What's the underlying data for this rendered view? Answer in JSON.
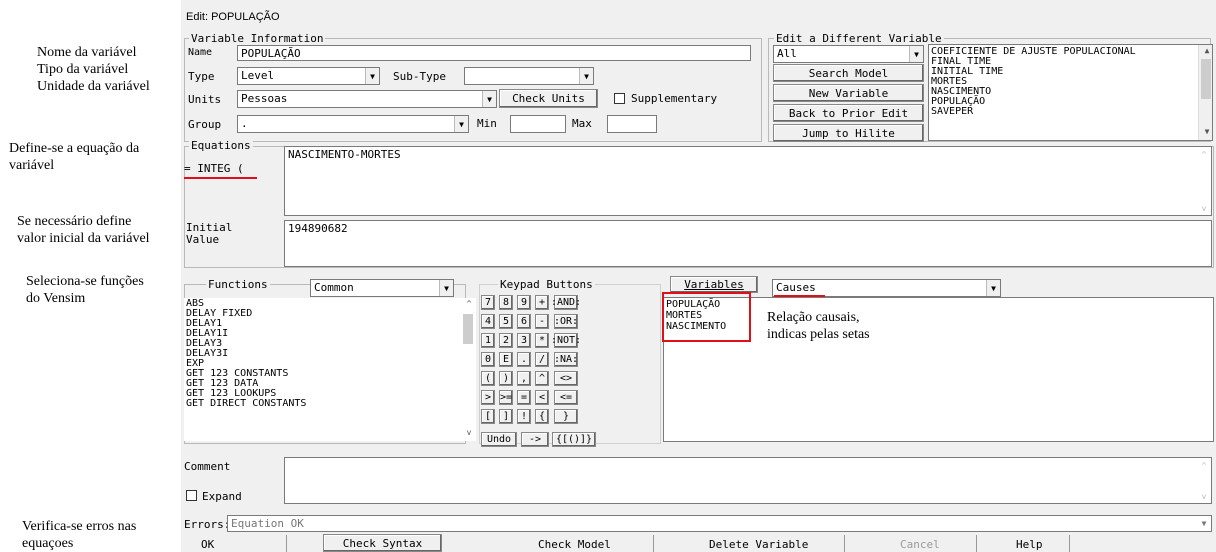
{
  "annotations": {
    "nome": "Nome da variável",
    "tipo": "Tipo da variável",
    "unidade": "Unidade da variável",
    "equacao_l1": "Define-se a equação da",
    "equacao_l2": "variável",
    "inicial_l1": "Se necessário define",
    "inicial_l2": "valor inicial da variável",
    "funcoes_l1": "Seleciona-se funções",
    "funcoes_l2": "do Vensim",
    "causal_l1": "Relação causais,",
    "causal_l2": "indicas pelas setas",
    "erros_l1": "Verifica-se erros nas",
    "erros_l2": "equaçoes"
  },
  "window": {
    "title": "Edit: POPULAÇÃO"
  },
  "variable_info": {
    "group_title": "Variable Information",
    "name_label": "Name",
    "name_value": "POPULAÇÃO",
    "type_label": "Type",
    "type_value": "Level",
    "subtype_label": "Sub-Type",
    "subtype_value": "",
    "units_label": "Units",
    "units_value": "Pessoas",
    "check_units": "Check Units",
    "supplementary": "Supplementary",
    "group_label": "Group",
    "group_value": ".",
    "min_label": "Min",
    "max_label": "Max"
  },
  "edit_different": {
    "group_title": "Edit a Different Variable",
    "filter_value": "All",
    "search_model": "Search Model",
    "new_variable": "New Variable",
    "back_prior": "Back to Prior Edit",
    "jump_hilite": "Jump to Hilite",
    "variables": [
      "COEFICIENTE DE AJUSTE POPULACIONAL",
      "FINAL TIME",
      "INITIAL TIME",
      "MORTES",
      "NASCIMENTO",
      "POPULAÇÃO",
      "SAVEPER"
    ]
  },
  "equations": {
    "group_title": "Equations",
    "integ_label": "= INTEG (",
    "equation_value": "NASCIMENTO-MORTES",
    "initial_label_1": "Initial",
    "initial_label_2": "Value",
    "initial_value": "194890682"
  },
  "functions": {
    "group_title": "Functions",
    "category": "Common",
    "items": [
      "ABS",
      "DELAY FIXED",
      "DELAY1",
      "DELAY1I",
      "DELAY3",
      "DELAY3I",
      "EXP",
      "GET 123 CONSTANTS",
      "GET 123 DATA",
      "GET 123 LOOKUPS",
      "GET DIRECT CONSTANTS"
    ]
  },
  "keypad": {
    "group_title": "Keypad Buttons",
    "rows": [
      [
        "7",
        "8",
        "9",
        "+",
        ":AND:"
      ],
      [
        "4",
        "5",
        "6",
        "-",
        ":OR:"
      ],
      [
        "1",
        "2",
        "3",
        "*",
        ":NOT:"
      ],
      [
        "0",
        "E",
        ".",
        "/",
        ":NA:"
      ],
      [
        "(",
        ")",
        ",",
        "^",
        "<>"
      ],
      [
        ">",
        ">=",
        "=",
        "<",
        "<="
      ],
      [
        "[",
        "]",
        "!",
        "{",
        "}"
      ]
    ],
    "undo": "Undo",
    "arrow": "->",
    "brackets": "{[()]}"
  },
  "variables_panel": {
    "button": "Variables",
    "mode": "Causes",
    "items": [
      "POPULAÇÃO",
      "MORTES",
      "NASCIMENTO"
    ]
  },
  "comment": {
    "label": "Comment",
    "expand": "Expand"
  },
  "errors": {
    "label": "Errors:",
    "value": "Equation OK"
  },
  "bottom_buttons": {
    "ok": "OK",
    "check_syntax": "Check Syntax",
    "check_model": "Check Model",
    "delete_variable": "Delete Variable",
    "cancel": "Cancel",
    "help": "Help"
  },
  "colors": {
    "highlight": "#e0101a",
    "dialog_bg": "#f0f0f0"
  }
}
